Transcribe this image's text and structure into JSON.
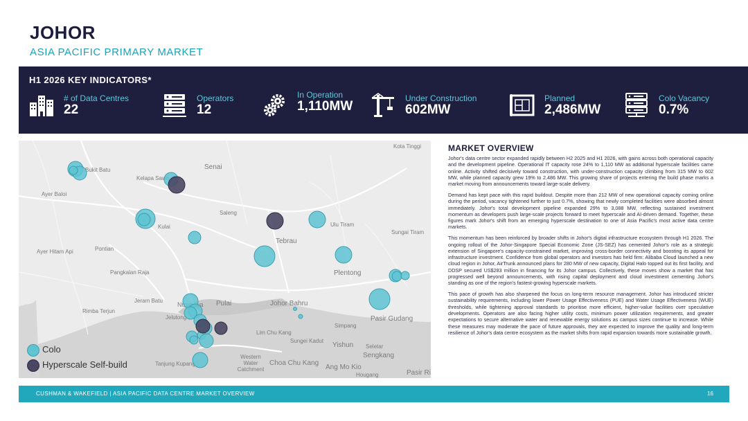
{
  "header": {
    "title": "JOHOR",
    "subtitle": "ASIA PACIFIC PRIMARY MARKET"
  },
  "indicators": {
    "title": "H1 2026 KEY INDICATORS*",
    "items": [
      {
        "label": "# of Data Centres",
        "value": "22",
        "icon": "buildings-icon"
      },
      {
        "label": "Operators",
        "value": "12",
        "icon": "server-rack-icon"
      },
      {
        "label": "In Operation",
        "value": "1,110MW",
        "icon": "gears-icon"
      },
      {
        "label": "Under Construction",
        "value": "602MW",
        "icon": "crane-icon"
      },
      {
        "label": "Planned",
        "value": "2,486MW",
        "icon": "blueprint-icon"
      },
      {
        "label": "Colo Vacancy",
        "value": "0.7%",
        "icon": "server-network-icon"
      }
    ]
  },
  "map": {
    "places": [
      "Kota Tinggi",
      "Senai",
      "Bukit Batu",
      "Kelapa Sawit",
      "Ayer Baloi",
      "Saleng",
      "Kulai",
      "Ulu Tiram",
      "Sungai Tiram",
      "Tebrau",
      "Ayer Hitam Api",
      "Pontian",
      "Pangkalan Raja",
      "Plentong",
      "Jeram Batu",
      "Nusajaya",
      "Pulai",
      "Johor Bahru",
      "Rimba Terjun",
      "Jelutong",
      "Pasir Gudang",
      "Lim Chu Kang",
      "Sungei Kadut",
      "Simpang",
      "Yishun",
      "Seletar",
      "Sengkang",
      "Western Water Catchment",
      "Choa Chu Kang",
      "Tanjung Kupang",
      "Ang Mo Kio",
      "Hougang",
      "Pasir Ris"
    ],
    "legend": [
      {
        "label": "Colo",
        "color": "#5ec4d2"
      },
      {
        "label": "Hyperscale Self-build",
        "color": "#4a4763"
      }
    ]
  },
  "overview": {
    "title": "MARKET OVERVIEW",
    "paragraphs": [
      "Johor's data centre sector expanded rapidly between H2 2025 and H1 2026, with gains across both operational capacity and the development pipeline. Operational IT capacity rose 24% to 1,110 MW as additional hyperscale facilities came online. Activity shifted decisively toward construction, with under-construction capacity climbing from 315 MW to 602 MW, while planned capacity grew 19% to 2,486 MW. This growing share of projects entering the build phase marks a market moving from announcements toward large-scale delivery.",
      "Demand has kept pace with this rapid buildout. Despite more than 212 MW of new operational capacity coming online during the period, vacancy tightened further to just 0.7%, showing that newly completed facilities were absorbed almost immediately. Johor's total development pipeline expanded 29% to 3,088 MW, reflecting sustained investment momentum as developers push large-scale projects forward to meet hyperscale and AI-driven demand. Together, these figures mark Johor's shift from an emerging hyperscale destination to one of Asia Pacific's most active data centre markets.",
      "This momentum has been reinforced by broader shifts in Johor's digital infrastructure ecosystem through H1 2026. The ongoing rollout of the Johor-Singapore Special Economic Zone (JS-SEZ) has cemented Johor's role as a strategic extension of Singapore's capacity-constrained market, improving cross-border connectivity and boosting its appeal for infrastructure investment. Confidence from global operators and investors has held firm: Alibaba Cloud launched a new cloud region in Johor, AirTrunk announced plans for 280 MW of new capacity, Digital Halo topped out its first facility, and DDSP secured US$283 million in financing for its Johor campus. Collectively, these moves show a market that has progressed well beyond announcements, with rising capital deployment and cloud investment cementing Johor's standing as one of the region's fastest-growing hyperscale markets.",
      "This pace of growth has also sharpened the focus on long-term resource management. Johor has introduced stricter sustainability requirements, including lower Power Usage Effectiveness (PUE) and Water Usage Effectiveness (WUE) thresholds, while tightening approval standards to prioritise more efficient, higher-value facilities over speculative developments. Operators are also facing higher utility costs, minimum power utilization requirements, and greater expectations to secure alternative water and renewable energy solutions as campus sizes continue to increase. While these measures may moderate the pace of future approvals, they are expected to improve the quality and long-term resilience of Johor's data centre ecosystem as the market shifts from rapid expansion towards more sustainable growth."
    ]
  },
  "footer": {
    "text": "CUSHMAN & WAKEFIELD  |  ASIA PACIFIC DATA CENTRE MARKET OVERVIEW",
    "page": "16"
  }
}
